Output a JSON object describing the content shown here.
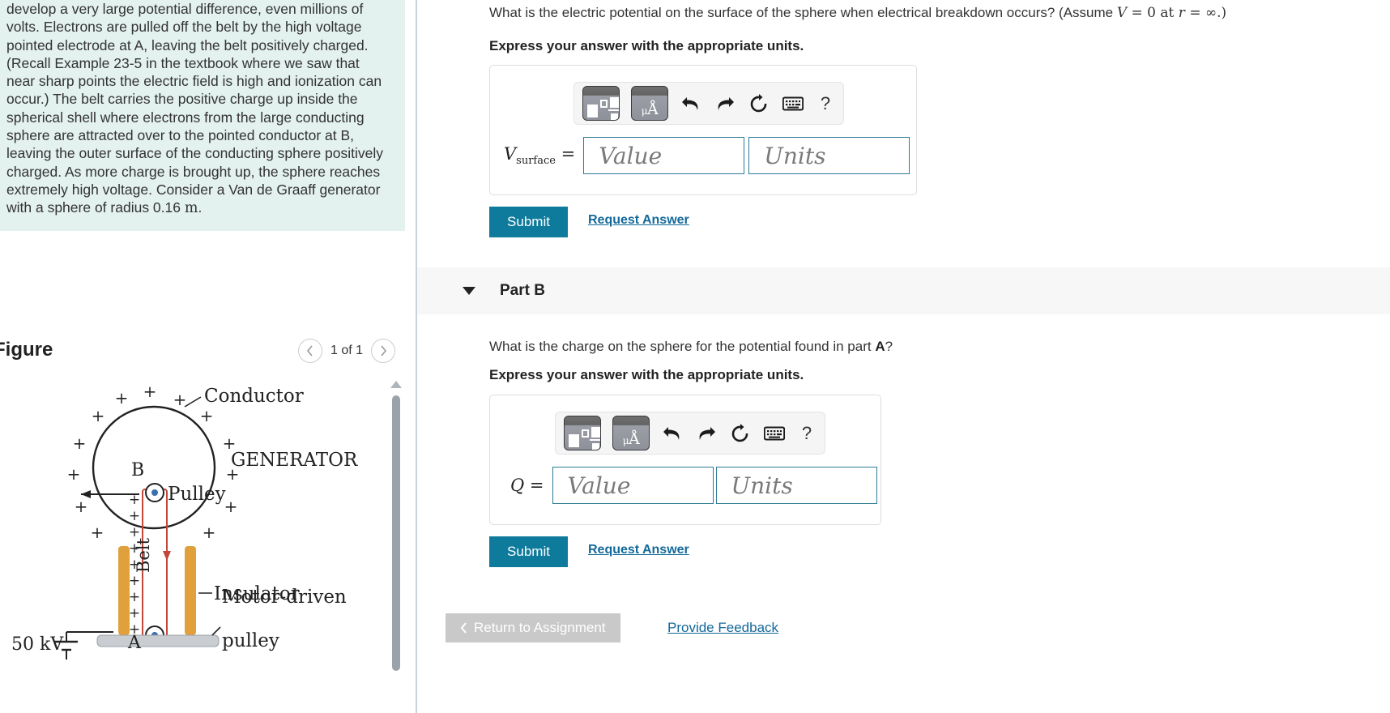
{
  "problem": {
    "text_segments": [
      "develop a very large potential difference, even millions of volts. Electrons are pulled off the belt by the high voltage pointed electrode at A, leaving the belt positively charged. (Recall Example 23-5 in the textbook where we saw that near sharp points the electric field is high and ionization can occur.) The belt carries the positive charge up inside the spherical shell where electrons from the large conducting sphere are attracted over to the pointed conductor at B, leaving the outer surface of the conducting sphere positively charged. As more charge is brought up, the sphere reaches extremely high voltage. Consider a Van de Graaff generator with a sphere of radius 0.16 ",
      "m",
      "."
    ]
  },
  "figure": {
    "title": "Figure",
    "prev_icon": "chevron-left-icon",
    "next_icon": "chevron-right-icon",
    "counter": "1 of 1",
    "labels": {
      "conductor": "Conductor",
      "generator": "GENERATOR",
      "pulley": "Pulley",
      "belt": "Belt",
      "insulator": "Insulator",
      "motor_driven": "Motor-driven",
      "pulley2": "pulley",
      "point_b": "B",
      "point_a": "A",
      "voltage": "50 kV",
      "plus": "+"
    }
  },
  "part_a": {
    "question_prefix": "What is the electric potential on the surface of the sphere when electrical breakdown occurs? (Assume ",
    "question_math_v": "V",
    "question_eq1": " = 0 at ",
    "question_math_r": "r",
    "question_eq2": " = ∞.)",
    "instruction": "Express your answer with the appropriate units.",
    "toolbar": {
      "template_icon": "math-template-icon",
      "units_icon": "units-micro-angstrom-icon",
      "units_glyph_small": "μ",
      "units_glyph_main": "Å",
      "undo_icon": "undo-arrow-icon",
      "redo_icon": "redo-arrow-icon",
      "reset_icon": "reset-circular-arrow-icon",
      "keyboard_icon": "keyboard-icon",
      "help_icon": "question-mark-icon",
      "help_label": "?"
    },
    "field_label_var": "V",
    "field_label_sub": "surface",
    "field_label_eq": " =",
    "value_placeholder": "Value",
    "units_placeholder": "Units",
    "submit_label": "Submit",
    "request_answer_label": "Request Answer"
  },
  "part_b": {
    "header_label": "Part B",
    "caret_icon": "caret-down-icon",
    "question_prefix": "What is the charge on the sphere for the potential found in part ",
    "question_bold": "A",
    "question_suffix": "?",
    "instruction": "Express your answer with the appropriate units.",
    "toolbar": {
      "template_icon": "math-template-icon",
      "units_icon": "units-micro-angstrom-icon",
      "units_glyph_small": "μ",
      "units_glyph_main": "Å",
      "undo_icon": "undo-arrow-icon",
      "redo_icon": "redo-arrow-icon",
      "reset_icon": "reset-circular-arrow-icon",
      "keyboard_icon": "keyboard-icon",
      "help_icon": "question-mark-icon",
      "help_label": "?"
    },
    "field_label_var": "Q",
    "field_label_eq": " =",
    "value_placeholder": "Value",
    "units_placeholder": "Units",
    "submit_label": "Submit",
    "request_answer_label": "Request Answer"
  },
  "footer": {
    "return_icon": "chevron-left-icon",
    "return_label": "Return to Assignment",
    "feedback_label": "Provide Feedback"
  },
  "colors": {
    "accent_teal": "#0f7b9c",
    "link_blue": "#13699a",
    "problem_bg": "#e3f1ef",
    "part_header_bg": "#f7f7f7",
    "field_border": "#2e7b96",
    "return_bg": "#c9c9c9"
  }
}
